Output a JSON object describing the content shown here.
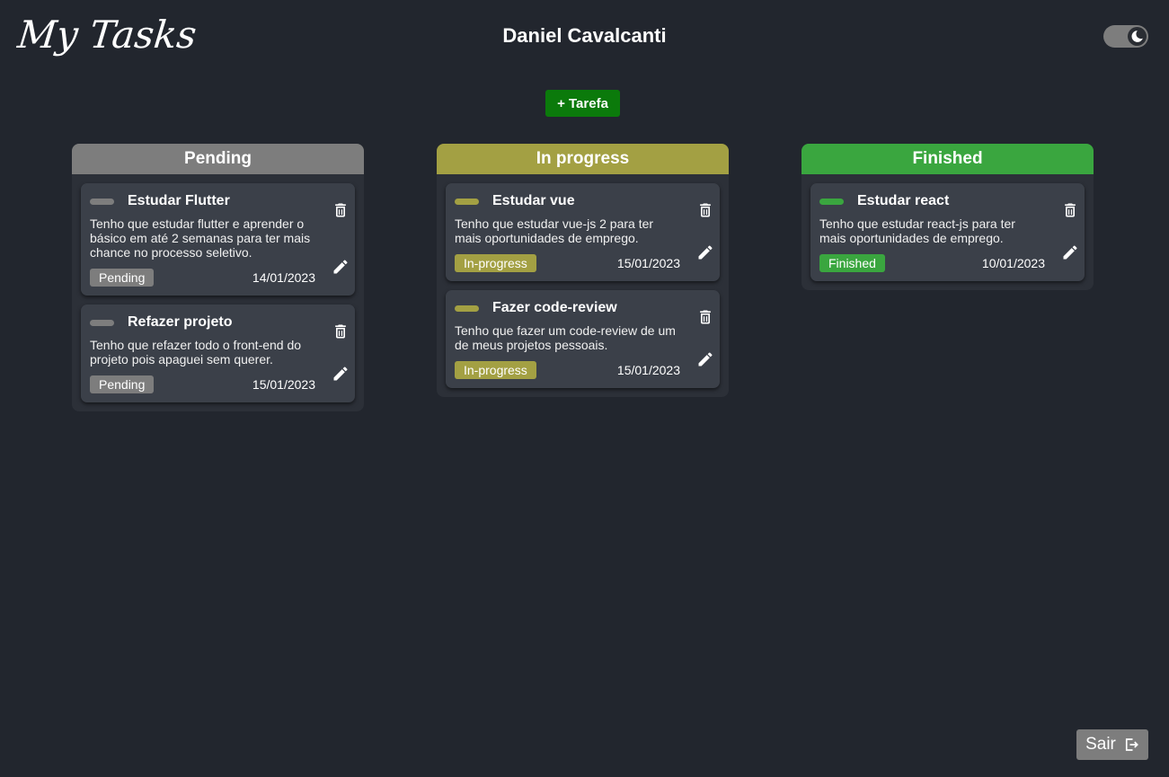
{
  "app": {
    "title": "My Tasks",
    "user_name": "Daniel Cavalcanti",
    "add_task_label": "+ Tarefa",
    "logout_label": "Sair",
    "theme": "dark"
  },
  "colors": {
    "background": "#22262e",
    "pending": "#7d7d7d",
    "in_progress": "#a3a043",
    "finished": "#3aa63f",
    "add_button": "#0b7a0b"
  },
  "columns": [
    {
      "title": "Pending",
      "tasks": [
        {
          "title": "Estudar Flutter",
          "description": "Tenho que estudar flutter e aprender o básico em até 2 semanas para ter mais chance no processo seletivo.",
          "status": "Pending",
          "date": "14/01/2023"
        },
        {
          "title": "Refazer projeto",
          "description": "Tenho que refazer todo o front-end do projeto pois apaguei sem querer.",
          "status": "Pending",
          "date": "15/01/2023"
        }
      ]
    },
    {
      "title": "In progress",
      "tasks": [
        {
          "title": "Estudar vue",
          "description": "Tenho que estudar vue-js 2 para ter mais oportunidades de emprego.",
          "status": "In-progress",
          "date": "15/01/2023"
        },
        {
          "title": "Fazer code-review",
          "description": "Tenho que fazer um code-review de um de meus projetos pessoais.",
          "status": "In-progress",
          "date": "15/01/2023"
        }
      ]
    },
    {
      "title": "Finished",
      "tasks": [
        {
          "title": "Estudar react",
          "description": "Tenho que estudar react-js para ter mais oportunidades de emprego.",
          "status": "Finished",
          "date": "10/01/2023"
        }
      ]
    }
  ],
  "icons": {
    "delete": "trash-icon",
    "edit": "pencil-icon",
    "theme": "moon-icon",
    "logout": "logout-icon"
  }
}
